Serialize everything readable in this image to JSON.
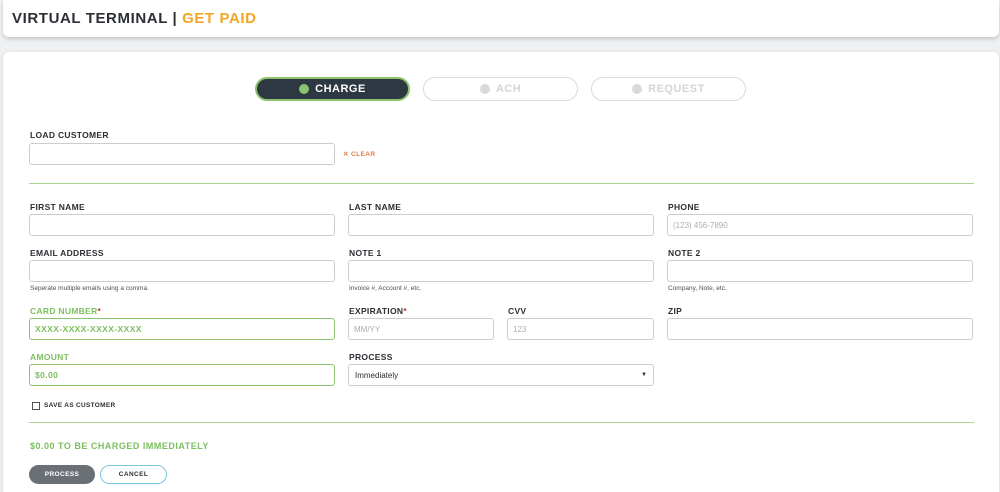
{
  "header": {
    "title_main": "VIRTUAL TERMINAL |",
    "title_accent": "GET PAID"
  },
  "tabs": [
    {
      "label": "CHARGE",
      "active": true
    },
    {
      "label": "ACH",
      "active": false
    },
    {
      "label": "REQUEST",
      "active": false
    }
  ],
  "load_customer": {
    "label": "LOAD CUSTOMER",
    "value": "",
    "clear_label": "✕ CLEAR"
  },
  "fields": {
    "first_name": {
      "label": "FIRST NAME",
      "value": "",
      "placeholder": ""
    },
    "last_name": {
      "label": "LAST NAME",
      "value": "",
      "placeholder": ""
    },
    "phone": {
      "label": "PHONE",
      "value": "",
      "placeholder": "(123) 456-7890"
    },
    "email": {
      "label": "EMAIL ADDRESS",
      "value": "",
      "placeholder": "",
      "hint": "Seperate multiple emails using a comma."
    },
    "note1": {
      "label": "NOTE 1",
      "value": "",
      "placeholder": "",
      "hint": "Invoice #, Account #, etc."
    },
    "note2": {
      "label": "NOTE 2",
      "value": "",
      "placeholder": "",
      "hint": "Company, Note, etc."
    },
    "card_number": {
      "label": "CARD NUMBER",
      "required_mark": "*",
      "value": "",
      "placeholder": "XXXX-XXXX-XXXX-XXXX"
    },
    "expiration": {
      "label": "EXPIRATION",
      "required_mark": "*",
      "value": "",
      "placeholder": "MM/YY"
    },
    "cvv": {
      "label": "CVV",
      "value": "",
      "placeholder": "123"
    },
    "zip": {
      "label": "ZIP",
      "value": "",
      "placeholder": ""
    },
    "amount": {
      "label": "AMOUNT",
      "value": "",
      "placeholder": "$0.00"
    },
    "process": {
      "label": "PROCESS",
      "selected": "Immediately"
    }
  },
  "save_as_customer": {
    "label": "SAVE AS CUSTOMER",
    "checked": false
  },
  "summary": {
    "text": "$0.00 TO BE CHARGED IMMEDIATELY"
  },
  "actions": {
    "process_label": "PROCESS",
    "cancel_label": "CANCEL"
  },
  "colors": {
    "accent": "#f5a623",
    "green": "#7cbf5e",
    "dark": "#2e3842",
    "clear": "#e07a4b",
    "cancel_border": "#7dc4e0"
  }
}
